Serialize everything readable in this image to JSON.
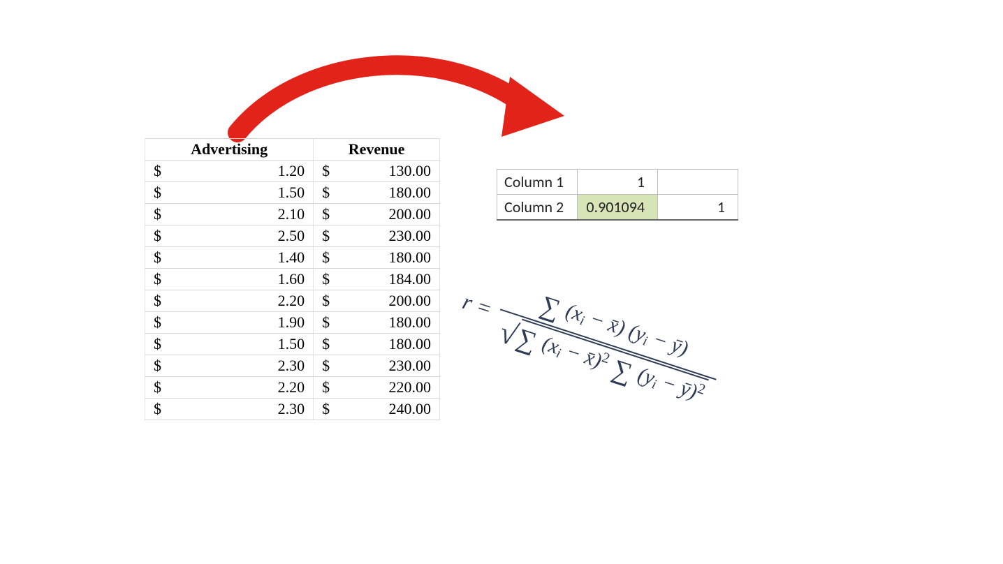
{
  "data_table": {
    "headers": {
      "col1": "Advertising",
      "col2": "Revenue"
    },
    "currency_symbol": "$",
    "rows": [
      {
        "adv": "1.20",
        "rev": "130.00"
      },
      {
        "adv": "1.50",
        "rev": "180.00"
      },
      {
        "adv": "2.10",
        "rev": "200.00"
      },
      {
        "adv": "2.50",
        "rev": "230.00"
      },
      {
        "adv": "1.40",
        "rev": "180.00"
      },
      {
        "adv": "1.60",
        "rev": "184.00"
      },
      {
        "adv": "2.20",
        "rev": "200.00"
      },
      {
        "adv": "1.90",
        "rev": "180.00"
      },
      {
        "adv": "1.50",
        "rev": "180.00"
      },
      {
        "adv": "2.30",
        "rev": "230.00"
      },
      {
        "adv": "2.20",
        "rev": "220.00"
      },
      {
        "adv": "2.30",
        "rev": "240.00"
      }
    ]
  },
  "correlation_matrix": {
    "row1_label": "Column 1",
    "row2_label": "Column 2",
    "r11": "1",
    "r12": "",
    "r21": "0.901094",
    "r22": "1"
  },
  "formula": {
    "lhs": "r =",
    "numerator": "∑ (xᵢ − x̄)(yᵢ − ȳ)",
    "denominator": "√ ∑ (xᵢ − x̄)² ∑ (yᵢ − ȳ)²",
    "plain": "r = Σ(x_i − x̄)(y_i − ȳ) / √[ Σ(x_i − x̄)² · Σ(y_i − ȳ)² ]"
  },
  "arrow": {
    "color": "#e2231a"
  }
}
